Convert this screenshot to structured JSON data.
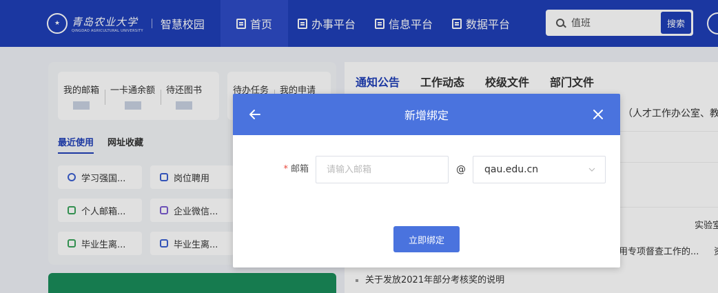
{
  "header": {
    "logo_cn": "青岛农业大学",
    "logo_en": "QINGDAO AGRICULTURAL UNIVERSITY",
    "logo_sub": "智慧校园",
    "nav": [
      "首页",
      "办事平台",
      "信息平台",
      "数据平台"
    ],
    "active_nav": 0,
    "search_value": "值班",
    "search_button": "搜索"
  },
  "left": {
    "quick_cards": [
      [
        "我的邮箱",
        "一卡通余额",
        "待还图书"
      ],
      [
        "待办任务",
        "我的申请"
      ]
    ],
    "tabs": [
      "最近使用",
      "网址收藏"
    ],
    "apps": [
      {
        "label": "学习强国...",
        "icon": "globe-icon",
        "color": "#3b5fd1"
      },
      {
        "label": "岗位聘用",
        "icon": "job-icon",
        "color": "#3b5fd1"
      },
      {
        "label": "个人邮箱...",
        "icon": "mail-icon",
        "color": "#3aa35a"
      },
      {
        "label": "企业微信...",
        "icon": "wechat-icon",
        "color": "#7a5bd0"
      },
      {
        "label": "毕业生离...",
        "icon": "grad-icon",
        "color": "#3aa35a"
      },
      {
        "label": "毕业生离...",
        "icon": "grad-doc-icon",
        "color": "#3b5fd1"
      }
    ]
  },
  "right": {
    "tabs": [
      "通知公告",
      "工作动态",
      "校级文件",
      "部门文件"
    ],
    "frag1": "（人才工作办公室、教师",
    "frag2": "实验室",
    "frag3": "用专项督查工作的...",
    "frag3b": "资",
    "news_last": "关于发放2021年部分考核奖的说明"
  },
  "modal": {
    "title": "新增绑定",
    "required_mark": "*",
    "email_label": "邮箱",
    "email_placeholder": "请输入邮箱",
    "at": "@",
    "domain": "qau.edu.cn",
    "submit": "立即绑定"
  },
  "colors": {
    "header_bg": "#1f3fb8",
    "modal_accent": "#4a73de"
  }
}
